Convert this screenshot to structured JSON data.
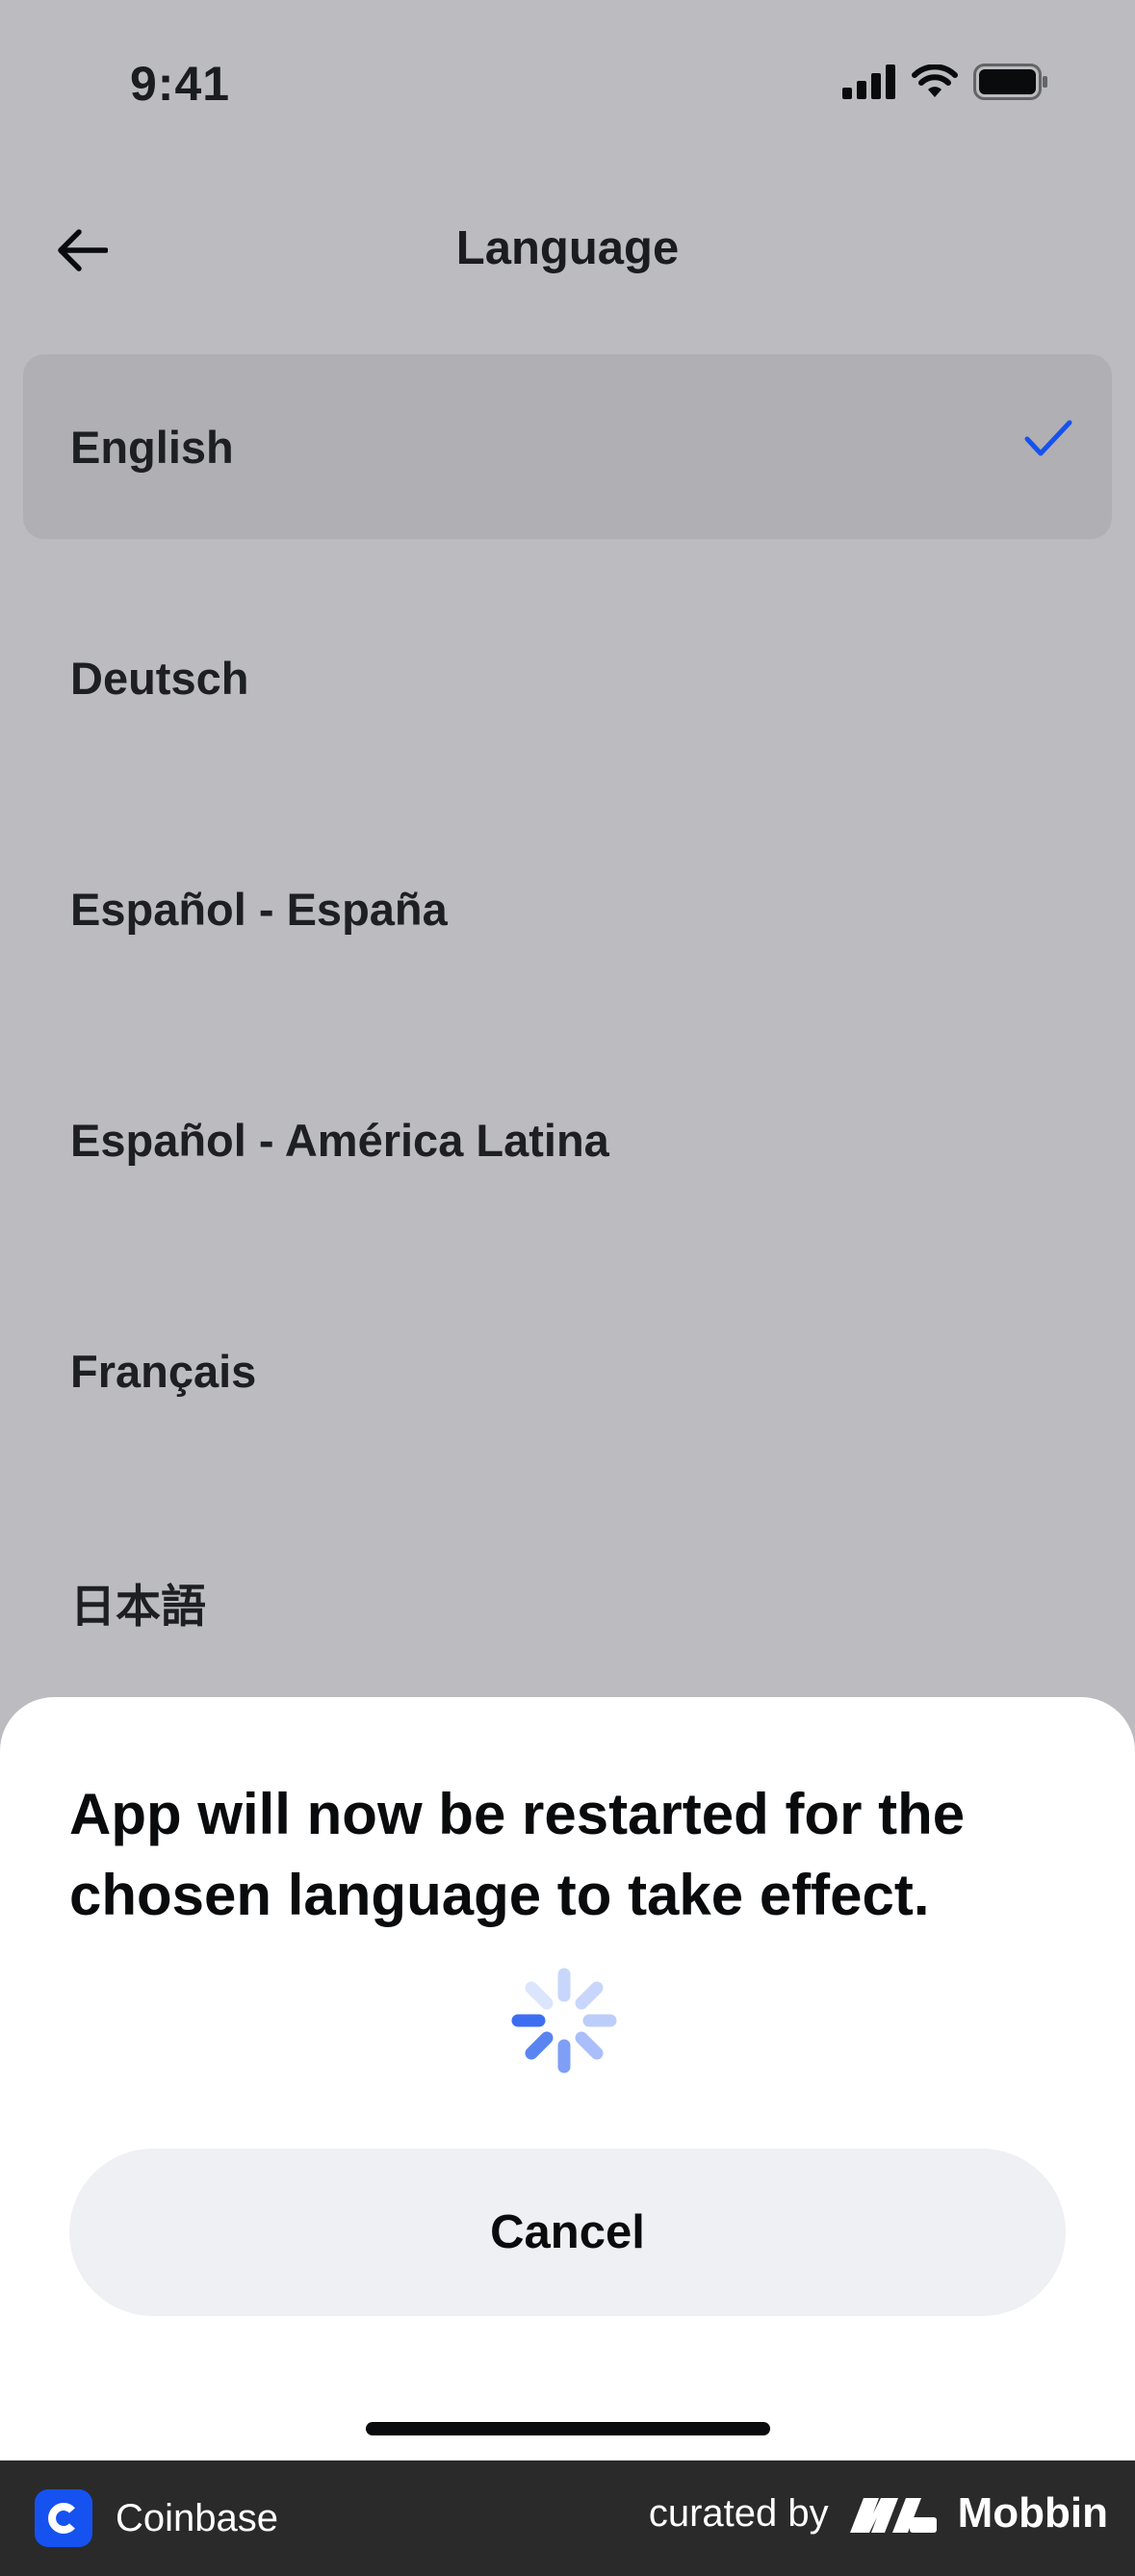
{
  "status_bar": {
    "time": "9:41"
  },
  "nav": {
    "title": "Language"
  },
  "languages": [
    {
      "label": "English",
      "selected": true
    },
    {
      "label": "Deutsch",
      "selected": false
    },
    {
      "label": "Español - España",
      "selected": false
    },
    {
      "label": "Español - América Latina",
      "selected": false
    },
    {
      "label": "Français",
      "selected": false
    },
    {
      "label": "日本語",
      "selected": false
    }
  ],
  "sheet": {
    "message": "App will now be restarted for the chosen language to take effect.",
    "cancel_label": "Cancel"
  },
  "footer": {
    "brand": "Coinbase",
    "curated_by": "curated by",
    "curator": "Mobbin"
  },
  "colors": {
    "accent": "#1652f0",
    "backdrop": "#bcbcc0",
    "selected_row": "#b0b0b4",
    "sheet": "#ffffff",
    "button": "#eef0f3"
  }
}
